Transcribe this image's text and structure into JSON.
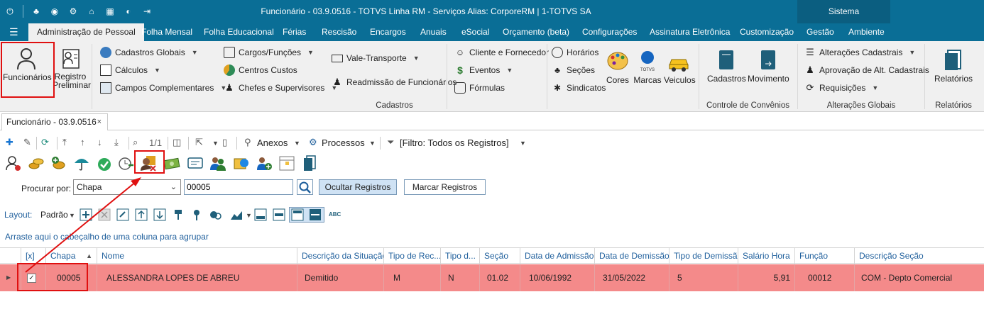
{
  "window": {
    "title": "Funcionário - 03.9.0516 - TOTVS Linha RM - Serviços  Alias: CorporeRM | 1-TOTVS SA",
    "sistema_label": "Sistema"
  },
  "tabs": [
    {
      "label": "Administração de Pessoal",
      "active": true
    },
    {
      "label": "Folha Mensal"
    },
    {
      "label": "Folha Educacional"
    },
    {
      "label": "Férias"
    },
    {
      "label": "Rescisão"
    },
    {
      "label": "Encargos"
    },
    {
      "label": "Anuais"
    },
    {
      "label": "eSocial"
    },
    {
      "label": "Orçamento (beta)"
    },
    {
      "label": "Configurações"
    },
    {
      "label": "Assinatura Eletrônica"
    },
    {
      "label": "Customização"
    },
    {
      "label": "Gestão"
    },
    {
      "label": "Ambiente"
    }
  ],
  "ribbon": {
    "funcionarios": "Funcionários",
    "registro_preliminar_1": "Registro",
    "registro_preliminar_2": "Preliminar",
    "cadastros_globais": "Cadastros Globais",
    "calculos": "Cálculos",
    "campos_complementares": "Campos Complementares",
    "cargos_funcoes": "Cargos/Funções",
    "centros_custos": "Centros Custos",
    "chefes_supervisores": "Chefes e Supervisores",
    "vale_transporte": "Vale-Transporte",
    "readmissao": "Readmissão de Funcionários",
    "cliente_fornecedor": "Cliente e Fornecedor",
    "eventos": "Eventos",
    "formulas": "Fórmulas",
    "horarios": "Horários",
    "secoes": "Seções",
    "sindicatos": "Sindicatos",
    "cores": "Cores",
    "marcas": "Marcas",
    "veiculos": "Veiculos",
    "totvs_logo": "TOTVS",
    "group_cadastros": "Cadastros",
    "cadastros_btn": "Cadastros",
    "movimento_btn": "Movimento",
    "group_convenios": "Controle de Convênios",
    "alteracoes_cadastrais": "Alterações Cadastrais",
    "aprovacao": "Aprovação de Alt. Cadastrais",
    "requisicoes": "Requisições",
    "group_alteracoes": "Alterações Globais",
    "relatorios_btn": "Relatórios",
    "group_relatorios": "Relatórios"
  },
  "doc_tab": {
    "label": "Funcionário - 03.9.0516",
    "close": "×"
  },
  "toolbar": {
    "page_indicator": "1/1",
    "anexos": "Anexos",
    "processos": "Processos",
    "filtro": "[Filtro: Todos os Registros]"
  },
  "search": {
    "label": "Procurar por:",
    "field": "Chapa",
    "value": "00005",
    "ocultar": "Ocultar Registros",
    "marcar": "Marcar Registros"
  },
  "layout": {
    "label": "Layout:",
    "value": "Padrão",
    "abc": "ABC"
  },
  "group_hint": "Arraste aqui o cabeçalho de uma coluna para agrupar",
  "grid": {
    "columns": [
      "[x]",
      "Chapa",
      "Nome",
      "Descrição da Situação",
      "Tipo de Rec...",
      "Tipo d...",
      "Seção",
      "Data de Admissão",
      "Data de Demissão",
      "Tipo de Demissão",
      "Salário Hora",
      "Função",
      "Descrição Seção"
    ],
    "rows": [
      {
        "checked": "✓",
        "chapa": "00005",
        "nome": "ALESSANDRA LOPES DE ABREU",
        "situacao": "Demitido",
        "tipo_rec": "M",
        "tipo_d": "N",
        "secao": "01.02",
        "admissao": "10/06/1992",
        "demissao": "31/05/2022",
        "tipo_demissao": "5",
        "salario_hora": "5,91",
        "funcao": "00012",
        "desc_secao": "COM - Depto Comercial"
      }
    ]
  },
  "colors": {
    "titlebar": "#0a6e96",
    "row_highlight": "#f48a8a",
    "annotation_red": "#e01010"
  }
}
